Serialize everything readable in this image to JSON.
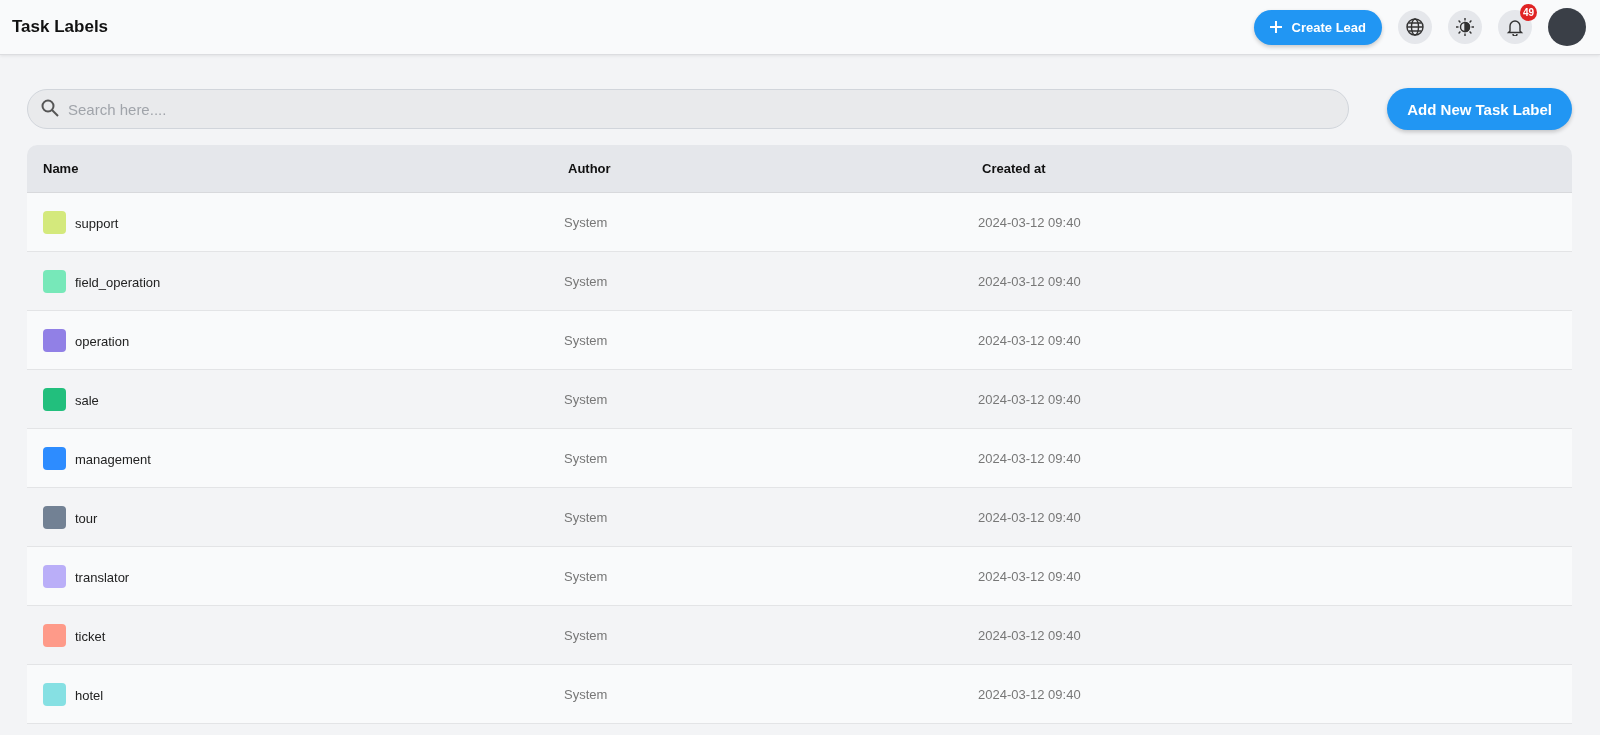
{
  "header": {
    "title": "Task Labels",
    "create_button": "Create Lead",
    "notification_count": "49"
  },
  "search": {
    "placeholder": "Search here...."
  },
  "add_button": "Add New Task Label",
  "table": {
    "columns": [
      "Name",
      "Author",
      "Created at"
    ],
    "rows": [
      {
        "name": "support",
        "color": "#d4e97c",
        "author": "System",
        "created_at": "2024-03-12 09:40"
      },
      {
        "name": "field_operation",
        "color": "#77e8b9",
        "author": "System",
        "created_at": "2024-03-12 09:40"
      },
      {
        "name": "operation",
        "color": "#9180e6",
        "author": "System",
        "created_at": "2024-03-12 09:40"
      },
      {
        "name": "sale",
        "color": "#22bf7d",
        "author": "System",
        "created_at": "2024-03-12 09:40"
      },
      {
        "name": "management",
        "color": "#2d8cff",
        "author": "System",
        "created_at": "2024-03-12 09:40"
      },
      {
        "name": "tour",
        "color": "#728194",
        "author": "System",
        "created_at": "2024-03-12 09:40"
      },
      {
        "name": "translator",
        "color": "#baaef8",
        "author": "System",
        "created_at": "2024-03-12 09:40"
      },
      {
        "name": "ticket",
        "color": "#fe9a89",
        "author": "System",
        "created_at": "2024-03-12 09:40"
      },
      {
        "name": "hotel",
        "color": "#86e0e3",
        "author": "System",
        "created_at": "2024-03-12 09:40"
      }
    ]
  }
}
